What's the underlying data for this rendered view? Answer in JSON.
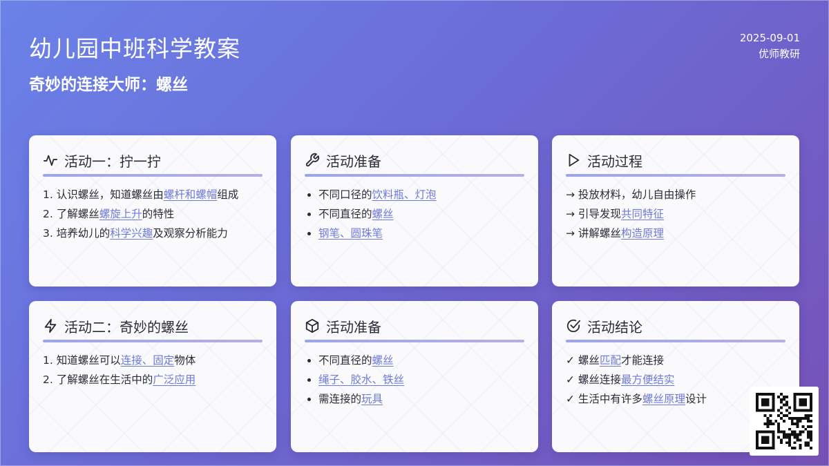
{
  "header": {
    "title": "幼儿园中班科学教案",
    "subtitle": "奇妙的连接大师：螺丝",
    "date": "2025-09-01",
    "author": "优师教研"
  },
  "cards": [
    {
      "title": "活动一：拧一拧",
      "icon": "activity-pulse-icon",
      "items": [
        {
          "marker": "1. ",
          "pre": "认识螺丝，知道螺丝由",
          "hl": "螺杆和螺帽",
          "post": "组成"
        },
        {
          "marker": "2. ",
          "pre": "了解螺丝",
          "hl": "螺旋上升",
          "post": "的特性"
        },
        {
          "marker": "3. ",
          "pre": "培养幼儿的",
          "hl": "科学兴趣",
          "post": "及观察分析能力"
        }
      ]
    },
    {
      "title": "活动准备",
      "icon": "wrench-icon",
      "items": [
        {
          "marker": "",
          "pre": "不同口径的",
          "hl": "饮料瓶、灯泡",
          "post": ""
        },
        {
          "marker": "",
          "pre": "不同直径的",
          "hl": "螺丝",
          "post": ""
        },
        {
          "marker": "",
          "pre": "",
          "hl": "钢笔、圆珠笔",
          "post": ""
        }
      ]
    },
    {
      "title": "活动过程",
      "icon": "play-icon",
      "items": [
        {
          "marker": "→ ",
          "pre": "投放材料，幼儿自由操作",
          "hl": "",
          "post": ""
        },
        {
          "marker": "→ ",
          "pre": "引导发现",
          "hl": "共同特征",
          "post": ""
        },
        {
          "marker": "→ ",
          "pre": "讲解螺丝",
          "hl": "构造原理",
          "post": ""
        }
      ]
    },
    {
      "title": "活动二：奇妙的螺丝",
      "icon": "lightning-icon",
      "items": [
        {
          "marker": "1. ",
          "pre": "知道螺丝可以",
          "hl": "连接、固定",
          "post": "物体"
        },
        {
          "marker": "2. ",
          "pre": "了解螺丝在生活中的",
          "hl": "广泛应用",
          "post": ""
        }
      ]
    },
    {
      "title": "活动准备",
      "icon": "box-icon",
      "items": [
        {
          "marker": "",
          "pre": "不同直径的",
          "hl": "螺丝",
          "post": ""
        },
        {
          "marker": "",
          "pre": "",
          "hl": "绳子、胶水、铁丝",
          "post": ""
        },
        {
          "marker": "",
          "pre": "需连接的",
          "hl": "玩具",
          "post": ""
        }
      ]
    },
    {
      "title": "活动结论",
      "icon": "check-circle-icon",
      "items": [
        {
          "marker": "✓ ",
          "pre": "螺丝",
          "hl": "匹配",
          "post": "才能连接"
        },
        {
          "marker": "✓ ",
          "pre": "螺丝连接",
          "hl": "最方便结实",
          "post": ""
        },
        {
          "marker": "✓ ",
          "pre": "生活中有许多",
          "hl": "螺丝原理",
          "post": "设计"
        }
      ]
    }
  ],
  "qr": {
    "icon": "qr-code-icon"
  },
  "colors": {
    "accent": "#6d7ad8",
    "bg_start": "#6a82e8",
    "bg_end": "#7651b6"
  }
}
